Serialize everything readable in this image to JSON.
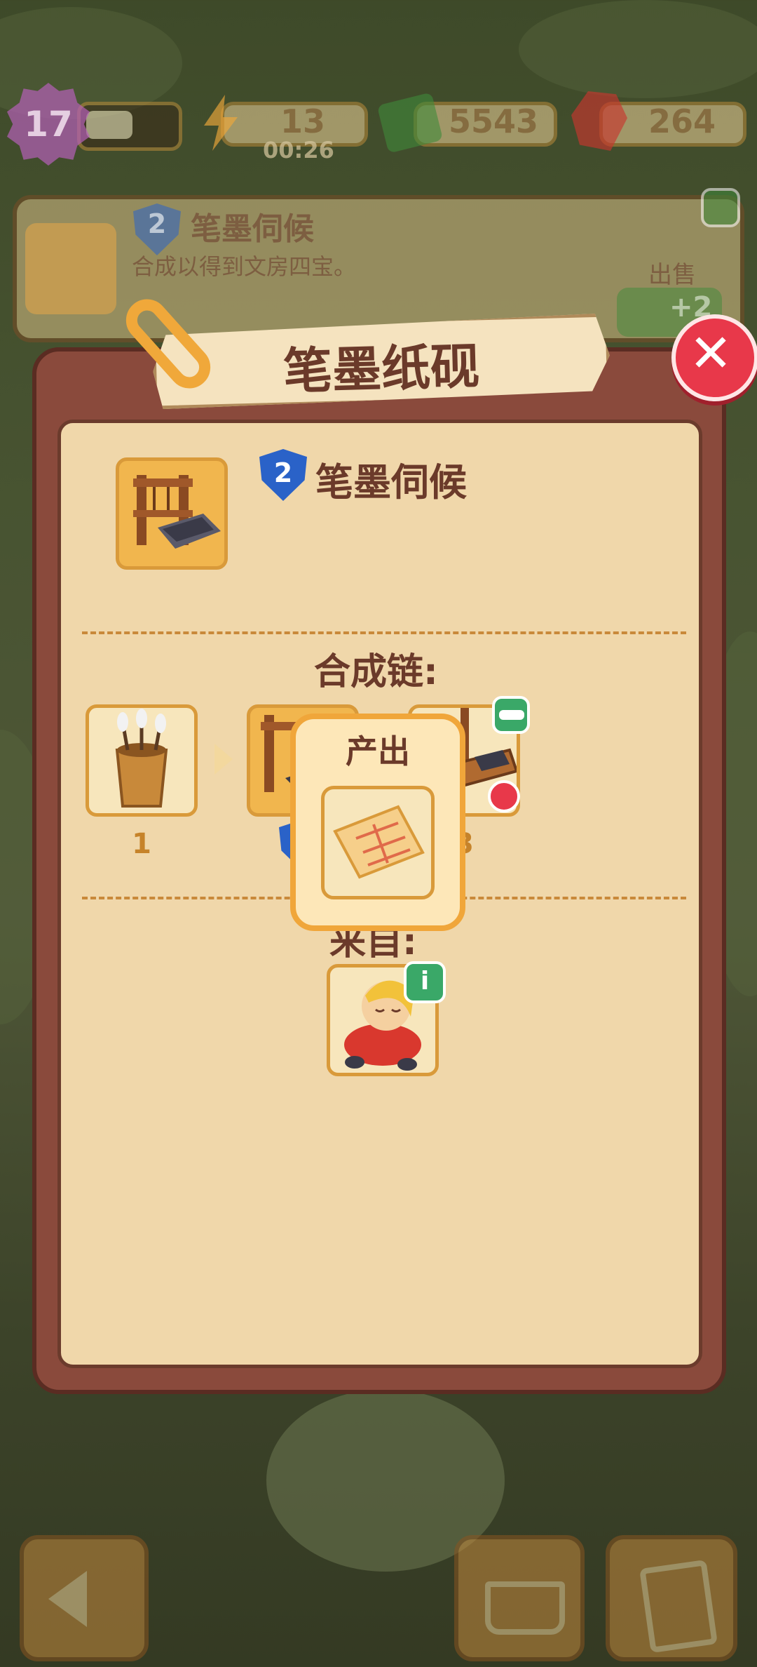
{
  "hud": {
    "level": "17",
    "xp_progress": 0.55,
    "energy": "13",
    "energy_timer": "00:26",
    "cash": "5543",
    "gems": "264"
  },
  "quest": {
    "level": "2",
    "name": "笔墨伺候",
    "description": "合成以得到文房四宝。",
    "sell_label": "出售",
    "sell_value": "+2"
  },
  "modal": {
    "title": "笔墨纸砚",
    "item_level": "2",
    "item_name": "笔墨伺候",
    "chain_label": "合成链:",
    "chain": [
      {
        "number": "1",
        "icon": "brush-pot-icon"
      },
      {
        "number": "",
        "icon": "brush-rack-inkstone-icon"
      },
      {
        "number": "3",
        "icon": "writing-desk-icon"
      }
    ],
    "source_label": "来自:",
    "source": {
      "icon": "sleeping-character-icon"
    }
  },
  "popup": {
    "title": "产出",
    "item": "paper-sheet-icon"
  },
  "colors": {
    "panel": "#f0d7aa",
    "frame": "#8a4a3c",
    "close": "#e8384a",
    "accent": "#f0a63a"
  }
}
